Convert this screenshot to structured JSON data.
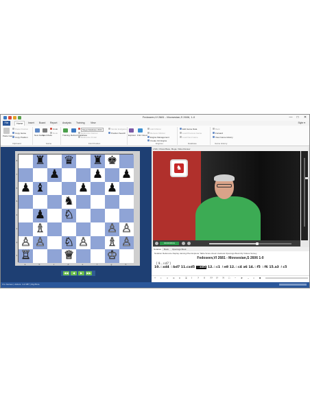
{
  "window": {
    "title": "Fedoseev,Vl 2681 - Movsesian,S 2606, 1-0",
    "controls": [
      "—",
      "□",
      "✕"
    ]
  },
  "menu": {
    "file": "File",
    "items": [
      "Home",
      "Insert",
      "Board",
      "Report",
      "Analysis",
      "Training",
      "View"
    ],
    "active": "Home",
    "right": "Style ▾"
  },
  "ribbon": {
    "clipboard": {
      "label": "Clipboard",
      "paste": "Paste Game",
      "items": [
        "Paste Position",
        "Copy Game",
        "Copy Position"
      ]
    },
    "game": {
      "label": "Game",
      "items": [
        "Undo",
        "Redo",
        "New Game",
        "Input Mode"
      ]
    },
    "find_position": {
      "label": "Find Position",
      "items": [
        "Mega Database 2022",
        "Reference Games",
        "Reference Finder",
        "Similar Endgames",
        "Position Search"
      ]
    },
    "engines": {
      "label": "Engines",
      "items": [
        "Add Kibitzer",
        "Remove Kibitzer",
        "Engine Management",
        "Create Uci Engine"
      ]
    },
    "database": {
      "label": "Database",
      "items": [
        "Edit Game Data",
        "Load Previous Game",
        "Load Next Game"
      ]
    },
    "game_history": {
      "label": "Game History",
      "items": [
        "Back",
        "Forward",
        "View Game History"
      ]
    },
    "explorer": [
      "Explorer",
      "Fritz Cloud"
    ],
    "buttons": [
      "Training",
      "Refresh Database",
      "Load Game"
    ]
  },
  "board": {
    "ranks": [
      "8",
      "7",
      "6",
      "5",
      "4",
      "3",
      "2",
      "1"
    ],
    "files": [
      "a",
      "b",
      "c",
      "d",
      "e",
      "f",
      "g",
      "h"
    ],
    "position": [
      [
        "",
        "r",
        "",
        "q",
        "",
        "r",
        "k",
        ""
      ],
      [
        "",
        "",
        "p",
        "",
        "",
        "p",
        "",
        "p"
      ],
      [
        "p",
        "b",
        "",
        "",
        "p",
        "",
        "p",
        ""
      ],
      [
        "",
        "",
        "",
        "n",
        "",
        "",
        "",
        ""
      ],
      [
        "",
        "p",
        "",
        "N",
        "",
        "",
        "",
        ""
      ],
      [
        "",
        "B",
        "",
        "",
        "",
        "",
        "P",
        "P"
      ],
      [
        "P",
        "P",
        "",
        "N",
        "P",
        "",
        "B",
        "P"
      ],
      [
        "R",
        "",
        "",
        "Q",
        "",
        "",
        "K",
        ""
      ]
    ],
    "pieces": {
      "K": "♔",
      "Q": "♕",
      "R": "♖",
      "B": "♗",
      "N": "♘",
      "P": "♙",
      "k": "♚",
      "q": "♛",
      "r": "♜",
      "b": "♝",
      "n": "♞",
      "p": "♟"
    },
    "colors": {
      "light": "#ffffff",
      "dark": "#8fa4d6",
      "panel": "#1e3f73"
    },
    "nav_buttons": [
      "◀◀",
      "◀",
      "▶",
      "▶▶"
    ]
  },
  "video": {
    "title": "LIVE | Chess Base, Mega, Video Review",
    "timecode": "00:00:08:01",
    "seek_progress": 0.58,
    "volume_level": 0.72
  },
  "notation": {
    "tabs": [
      "Notation",
      "Book",
      "Openings Book"
    ],
    "active_tab": "Notation",
    "menu": "Notation  Reference  Replay training  Plan Explorer  Table  Score sheet  Livebook  Openings Book  My Videos  Survey",
    "header": "Fedoseev,Vl 2681 - Movsesian,S 2606  1-0",
    "previous": "[ 9...♗d7 ]",
    "moves_before": "10.♘xd4 ♘bd7 11.cxd5 ",
    "current_move": "♘xd5",
    "moves_after": " 12.♘c1 ♗e8 12.♘c4 a6 14.♘f5 ♘f6 15.a3 ♗c5",
    "tools": [
      "+",
      "↕",
      "=",
      "∞",
      "±",
      "∓",
      "!",
      "?",
      "!!",
      "??",
      "!?",
      "?!",
      "□",
      "−",
      "➤",
      "→",
      "○",
      "■"
    ]
  },
  "status": {
    "text": "3 to Games | visitors: 4 of 087 | Digi Bore"
  }
}
